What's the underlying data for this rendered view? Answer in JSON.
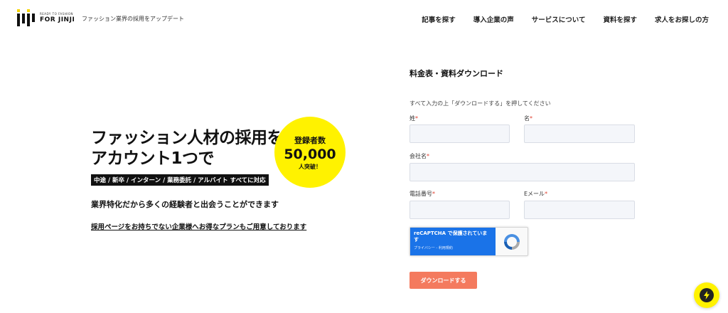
{
  "header": {
    "logo_small": "READY TO FASHION",
    "logo_big": "FOR JINJI",
    "tagline": "ファッション業界の採用をアップデート",
    "nav": [
      {
        "label": "記事を探す"
      },
      {
        "label": "導入企業の声"
      },
      {
        "label": "サービスについて"
      },
      {
        "label": "資料を探す"
      },
      {
        "label": "求人をお探しの方"
      }
    ]
  },
  "hero": {
    "title_line1": "ファッション人材の採用を",
    "title_line2": "アカウント1つで",
    "badge": {
      "line1": "登録者数",
      "line2": "50,000",
      "line3": "人突破！"
    },
    "tags": "中途 / 新卒 / インターン / 業務委託 / アルバイト すべてに対応",
    "subtitle": "業界特化だから多くの経験者と出会うことができます",
    "link": "採用ページをお持ちでない企業様へお得なプランもご用意しております"
  },
  "form": {
    "title": "料金表・資料ダウンロード",
    "instruction": "すべて入力の上「ダウンロードする」を押してください",
    "fields": {
      "last_name": {
        "label": "姓",
        "value": ""
      },
      "first_name": {
        "label": "名",
        "value": ""
      },
      "company": {
        "label": "会社名",
        "value": ""
      },
      "phone": {
        "label": "電話番号",
        "value": ""
      },
      "email": {
        "label": "Eメール",
        "value": ""
      }
    },
    "required_mark": "*",
    "recaptcha": {
      "text": "reCAPTCHA で保護されています",
      "links": "プライバシー - 利用規約"
    },
    "submit_label": "ダウンロードする"
  },
  "colors": {
    "accent_yellow": "#fff200",
    "button_orange": "#f47a5e",
    "recaptcha_blue": "#1a73e8"
  }
}
